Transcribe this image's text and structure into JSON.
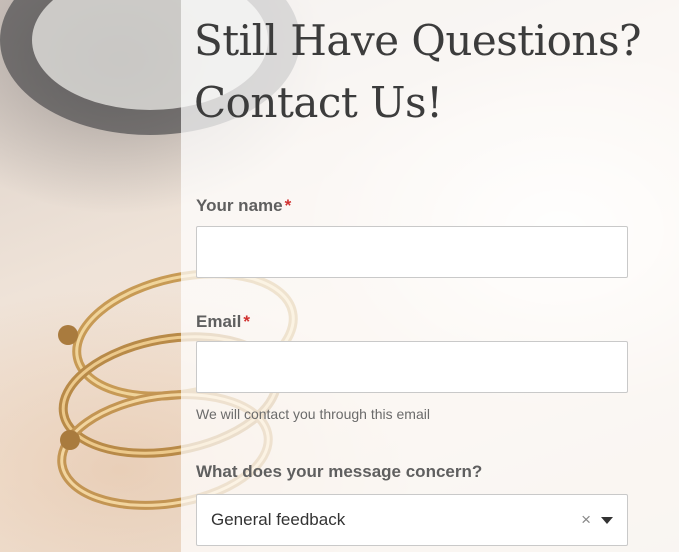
{
  "form": {
    "title_line1": "Still Have Questions?",
    "title_line2": "Contact Us!",
    "name_label": "Your name",
    "name_value": "",
    "email_label": "Email",
    "email_value": "",
    "email_help": "We will contact you through this email",
    "required_marker": "*",
    "concern_label": "What does your message concern?",
    "concern_selected": "General feedback",
    "clear_symbol": "×"
  },
  "colors": {
    "required": "#d0302f",
    "label": "#5f5f5f",
    "title": "#3c3c3c"
  },
  "icons": {
    "clear": "close-icon",
    "dropdown": "chevron-down-icon"
  }
}
